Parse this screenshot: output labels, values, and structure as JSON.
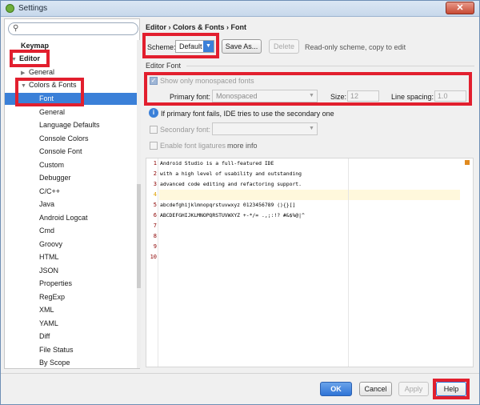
{
  "window": {
    "title": "Settings",
    "close_label": "✕"
  },
  "search": {
    "placeholder": ""
  },
  "sidebar": {
    "keymap": "Keymap",
    "editor": "Editor",
    "general": "General",
    "colors_fonts": "Colors & Fonts",
    "items": [
      "Font",
      "General",
      "Language Defaults",
      "Console Colors",
      "Console Font",
      "Custom",
      "Debugger",
      "C/C++",
      "Java",
      "Android Logcat",
      "Cmd",
      "Groovy",
      "HTML",
      "JSON",
      "Properties",
      "RegExp",
      "XML",
      "YAML",
      "Diff",
      "File Status",
      "By Scope"
    ]
  },
  "main": {
    "breadcrumb": "Editor › Colors & Fonts › Font",
    "scheme_label": "Scheme:",
    "scheme_value": "Default",
    "save_as": "Save As...",
    "delete": "Delete",
    "readonly_note": "Read-only scheme, copy to edit",
    "editor_font_title": "Editor Font",
    "show_mono": "Show only monospaced fonts",
    "primary_font_label": "Primary font:",
    "primary_font_value": "Monospaced",
    "size_label": "Size:",
    "size_value": "12",
    "line_spacing_label": "Line spacing:",
    "line_spacing_value": "1.0",
    "info_text": "If primary font fails, IDE tries to use the secondary one",
    "secondary_font_label": "Secondary font:",
    "ligatures_label": "Enable font ligatures",
    "more_info": "more info"
  },
  "preview": {
    "line_numbers": [
      "1",
      "2",
      "3",
      "4",
      "5",
      "6",
      "7",
      "8",
      "9",
      "10"
    ],
    "lines": [
      "Android Studio is a full-featured IDE",
      "with a high level of usability and outstanding",
      "advanced code editing and refactoring support.",
      "",
      "abcdefghijklmnopqrstuvwxyz 0123456789 (){}[]",
      "ABCDEFGHIJKLMNOPQRSTUVWXYZ +-*/= .,;:!? #&$%@|^",
      "",
      "",
      "",
      ""
    ]
  },
  "footer": {
    "ok": "OK",
    "cancel": "Cancel",
    "apply": "Apply",
    "help": "Help"
  },
  "colors": {
    "accent": "#3b80d8",
    "highlight": "#e21f2e",
    "line_number": "#8b0000"
  }
}
